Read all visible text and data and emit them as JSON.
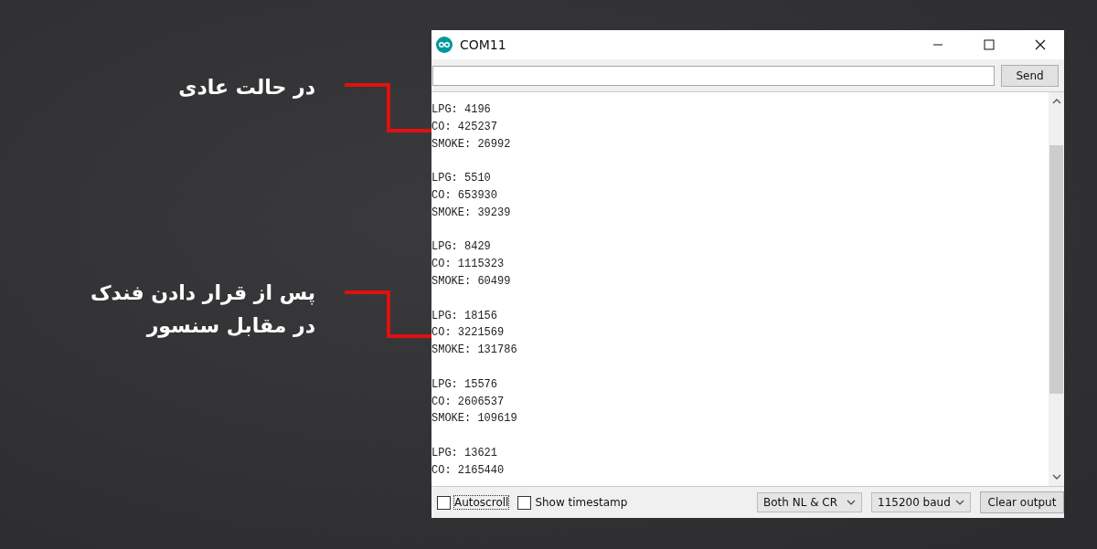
{
  "annotations": [
    {
      "lines": [
        "در حالت عادی"
      ]
    },
    {
      "lines": [
        "پس از قرار دادن فندک",
        "در مقابل سنسور"
      ]
    }
  ],
  "window": {
    "title": "COM11"
  },
  "send_button": "Send",
  "output_blocks": [
    [
      "LPG: 4196",
      "CO: 425237",
      "SMOKE: 26992"
    ],
    [
      "LPG: 5510",
      "CO: 653930",
      "SMOKE: 39239"
    ],
    [
      "LPG: 8429",
      "CO: 1115323",
      "SMOKE: 60499"
    ],
    [
      "LPG: 18156",
      "CO: 3221569",
      "SMOKE: 131786"
    ],
    [
      "LPG: 15576",
      "CO: 2606537",
      "SMOKE: 109619"
    ],
    [
      "LPG: 13621",
      "CO: 2165440"
    ]
  ],
  "footer": {
    "checkboxes": [
      {
        "label": "Autoscroll",
        "checked": false
      },
      {
        "label": "Show timestamp",
        "checked": false
      }
    ],
    "dropdowns": [
      "Both NL & CR",
      "115200 baud"
    ],
    "clear_button": "Clear output"
  }
}
